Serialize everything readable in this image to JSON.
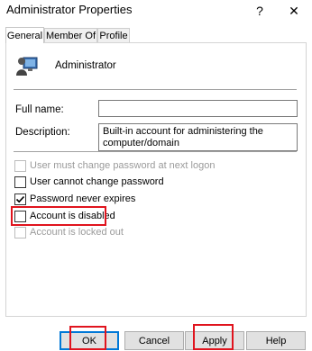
{
  "window": {
    "title": "Administrator Properties",
    "help_glyph": "?",
    "close_glyph": "✕"
  },
  "tabs": [
    {
      "label": "General",
      "active": true
    },
    {
      "label": "Member Of",
      "active": false
    },
    {
      "label": "Profile",
      "active": false
    }
  ],
  "user": {
    "name": "Administrator",
    "icon": "user-monitor-icon"
  },
  "fields": {
    "full_name_label": "Full name:",
    "full_name_value": "",
    "description_label": "Description:",
    "description_value": "Built-in account for administering the computer/domain"
  },
  "checkboxes": [
    {
      "label": "User must change password at next logon",
      "checked": false,
      "enabled": false
    },
    {
      "label": "User cannot change password",
      "checked": false,
      "enabled": true
    },
    {
      "label": "Password never expires",
      "checked": true,
      "enabled": true
    },
    {
      "label": "Account is disabled",
      "checked": false,
      "enabled": true
    },
    {
      "label": "Account is locked out",
      "checked": false,
      "enabled": false
    }
  ],
  "buttons": {
    "ok": "OK",
    "cancel": "Cancel",
    "apply": "Apply",
    "help": "Help"
  },
  "colors": {
    "highlight": "#e0141e",
    "default_button_border": "#0078d7"
  }
}
